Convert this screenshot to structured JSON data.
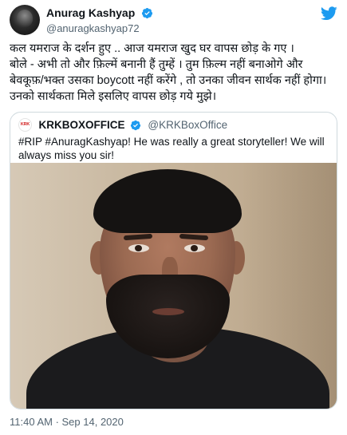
{
  "author": {
    "display_name": "Anurag Kashyap",
    "handle": "@anuragkashyap72",
    "verified": true
  },
  "tweet_text": "कल यमराज के दर्शन हुए .. आज यमराज खुद घर वापस छोड़ के गए ।\nबोले - अभी तो और फ़िल्में बनानी हैं तुम्हें । तुम फ़िल्म नहीं बनाओगे और बेवकूफ़/भक्त उसका boycott नहीं करेंगे , तो उनका जीवन सार्थक नहीं होगा। उनको सार्थकता मिले इसलिए वापस छोड़ गये मुझे।",
  "quoted_tweet": {
    "display_name": "KRKBOXOFFICE",
    "handle": "@KRKBoxOffice",
    "verified": true,
    "avatar_text": "KRK",
    "text": "#RIP #AnuragKashyap! He was really a great storyteller! We will always miss you sir!"
  },
  "timestamp": "11:40 AM · Sep 14, 2020",
  "icons": {
    "brand": "twitter-bird-icon",
    "verified": "verified-badge-icon"
  },
  "colors": {
    "twitter_blue": "#1d9bf0",
    "text_primary": "#0f1419",
    "text_secondary": "#536471",
    "border": "#cfd9de"
  }
}
